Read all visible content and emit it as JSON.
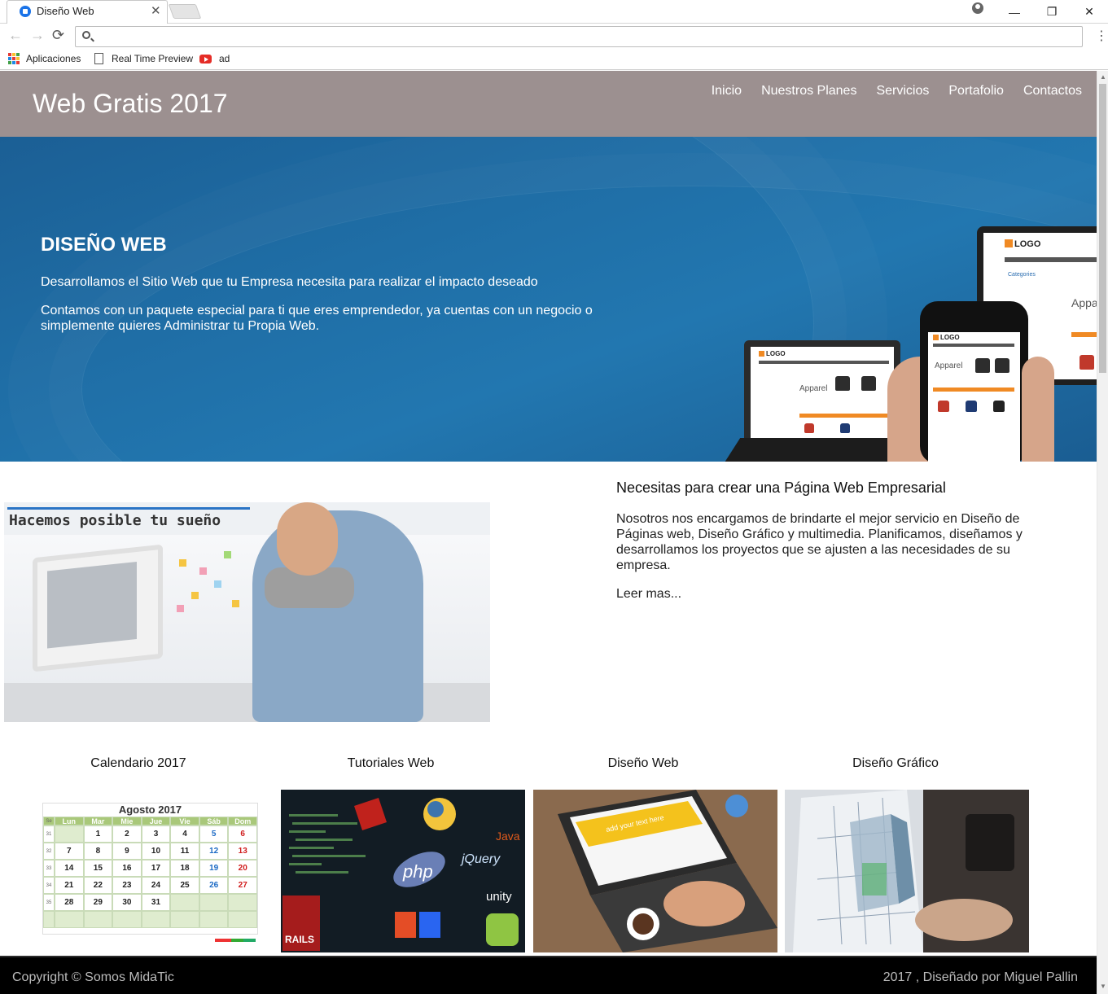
{
  "browser": {
    "tab_title": "Diseño Web",
    "tab_close": "✕",
    "window_controls": {
      "minimize": "—",
      "maximize": "❐",
      "close": "✕"
    },
    "nav": {
      "back": "←",
      "forward": "→",
      "reload": "⟳",
      "menu": "⋮"
    },
    "address_value": "",
    "bookmarks": [
      {
        "label": "Aplicaciones",
        "icon": "apps-grid-icon"
      },
      {
        "label": "Real Time Preview",
        "icon": "page-icon"
      },
      {
        "label": "ad",
        "icon": "youtube-icon"
      }
    ]
  },
  "site": {
    "brand": "Web Gratis 2017",
    "nav": [
      "Inicio",
      "Nuestros Planes",
      "Servicios",
      "Portafolio",
      "Contactos"
    ],
    "header_color": "#9c9090"
  },
  "hero": {
    "title": "DISEÑO WEB",
    "paragraph1": "Desarrollamos el Sitio Web que tu Empresa necesita para realizar el impacto deseado",
    "paragraph2": "Contamos con un paquete especial para ti que eres emprendedor, ya cuentas con un negocio o simplemente quieres Administrar tu Propia Web.",
    "devices": {
      "logo_text": "LOGO",
      "product_label": "Apparel",
      "categories_label": "Categories"
    }
  },
  "intro": {
    "image_caption": "Hacemos posible tu sueño",
    "title": "Necesitas para crear una Página Web Empresarial",
    "body": "Nosotros nos encargamos de brindarte el mejor servicio en Diseño de Páginas web, Diseño Gráfico y multimedia. Planificamos, diseñamos y desarrollamos los proyectos que se ajusten a las necesidades de su empresa.",
    "link": "Leer mas..."
  },
  "cards": [
    {
      "title": "Calendario 2017"
    },
    {
      "title": "Tutoriales Web",
      "logos": [
        "php",
        "jQuery",
        "unity",
        "Java",
        "RAILS"
      ]
    },
    {
      "title": "Diseño Web",
      "screen_text": "add your text here"
    },
    {
      "title": "Diseño Gráfico"
    }
  ],
  "calendar": {
    "title": "Agosto 2017",
    "headers": [
      "Se",
      "Lun",
      "Mar",
      "Mie",
      "Jue",
      "Vie",
      "Sáb",
      "Dom"
    ],
    "weeks": [
      [
        "31",
        "",
        "1",
        "2",
        "3",
        "4",
        "5",
        "6"
      ],
      [
        "32",
        "7",
        "8",
        "9",
        "10",
        "11",
        "12",
        "13"
      ],
      [
        "33",
        "14",
        "15",
        "16",
        "17",
        "18",
        "19",
        "20"
      ],
      [
        "34",
        "21",
        "22",
        "23",
        "24",
        "25",
        "26",
        "27"
      ],
      [
        "35",
        "28",
        "29",
        "30",
        "31",
        "",
        "",
        ""
      ],
      [
        "",
        "",
        "",
        "",
        "",
        "",
        "",
        ""
      ]
    ]
  },
  "footer": {
    "copyright": "Copyright © Somos MidaTic",
    "credit": "2017 , Diseñado por Miguel Pallin"
  }
}
